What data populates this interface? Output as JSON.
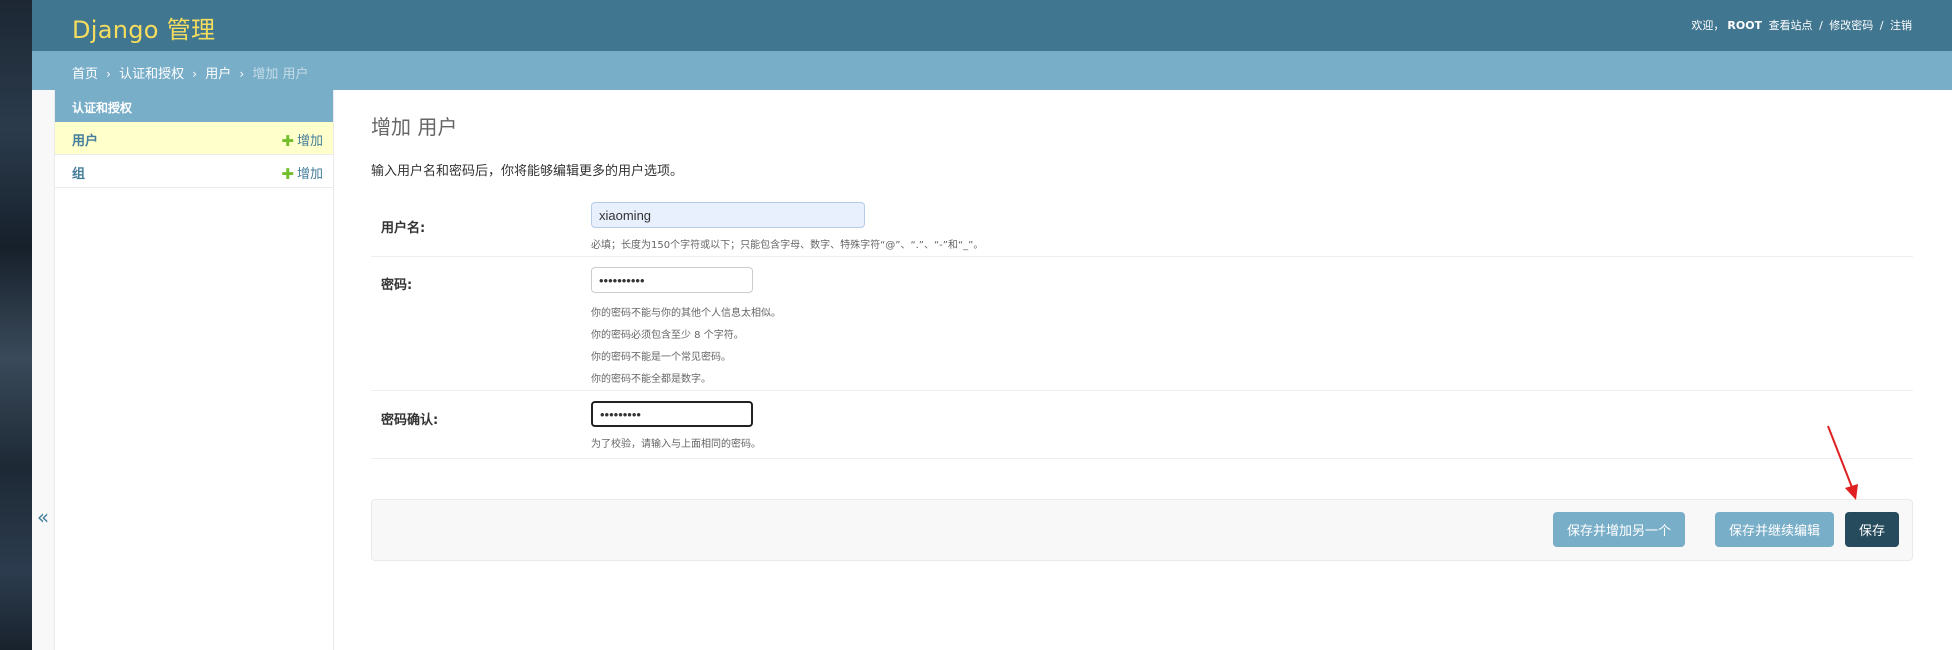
{
  "header": {
    "brand": "Django 管理",
    "welcome": "欢迎，",
    "username": "ROOT",
    "view_site": "查看站点",
    "sep1": "/",
    "change_password": "修改密码",
    "sep2": "/",
    "logout": "注销"
  },
  "breadcrumbs": {
    "home": "首页",
    "app": "认证和授权",
    "model": "用户",
    "current": "增加 用户",
    "sep": "›"
  },
  "sidebar": {
    "caption": "认证和授权",
    "items": [
      {
        "label": "用户",
        "add_label": "增加",
        "current": true
      },
      {
        "label": "组",
        "add_label": "增加",
        "current": false
      }
    ],
    "collapse_glyph": "«"
  },
  "content": {
    "title": "增加 用户",
    "intro": "输入用户名和密码后，你将能够编辑更多的用户选项。",
    "fields": {
      "username": {
        "label": "用户名:",
        "value": "xiaoming",
        "help": "必填；长度为150个字符或以下；只能包含字母、数字、特殊字符“@”、“.”、“-”和“_”。"
      },
      "password1": {
        "label": "密码:",
        "value": "••••••••••",
        "help": [
          "你的密码不能与你的其他个人信息太相似。",
          "你的密码必须包含至少 8 个字符。",
          "你的密码不能是一个常见密码。",
          "你的密码不能全都是数字。"
        ]
      },
      "password2": {
        "label": "密码确认:",
        "value": "•••••••••",
        "help": "为了校验，请输入与上面相同的密码。"
      }
    },
    "buttons": {
      "save_add_another": "保存并增加另一个",
      "save_continue": "保存并继续编辑",
      "save": "保存"
    }
  },
  "colors": {
    "header_bg": "#417690",
    "brand": "#f5dd5d",
    "breadcrumb_bg": "#79aec8",
    "primary_button": "#264b5d",
    "secondary_button": "#79aec8",
    "annotation_arrow": "#e02020"
  }
}
